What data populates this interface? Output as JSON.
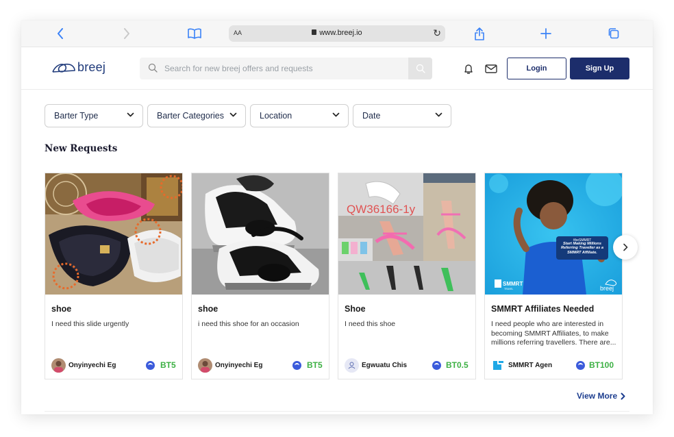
{
  "browser": {
    "aa_label": "AA",
    "url": "www.breej.io"
  },
  "header": {
    "brand": "breej",
    "search_placeholder": "Search for new breej offers and requests",
    "login_label": "Login",
    "signup_label": "Sign Up"
  },
  "filters": [
    {
      "label": "Barter Type"
    },
    {
      "label": "Barter Categories"
    },
    {
      "label": "Location"
    },
    {
      "label": "Date"
    }
  ],
  "section_title": "New Requests",
  "cards": [
    {
      "title": "shoe",
      "description": "I need this slide urgently",
      "user": "Onyinyechi Eg",
      "price": "BT5",
      "image": "pink-and-black-slides-photo"
    },
    {
      "title": "shoe",
      "description": "i need this shoe for an occasion",
      "user": "Onyinyechi Eg",
      "price": "BT5",
      "image": "black-white-sneakers-photo"
    },
    {
      "title": "Shoe",
      "description": "I need this shoe",
      "user": "Egwuatu Chis",
      "price": "BT0.5",
      "image": "pink-strappy-heels-collage",
      "image_overlay_text": "QW36166-1y"
    },
    {
      "title": "SMMRT Affiliates Needed",
      "description": "I need people who are interested in becoming SMMRT Affiliates, to make millions referring travellers. There are...",
      "user": "SMMRT Agen",
      "price": "BT100",
      "image": "smmrt-affiliate-promo-banner",
      "promo": {
        "hashtag": "#beSMMRT",
        "tagline": "Start Making Millions Referring Traveller as a SMMRT Affiliate.",
        "brand": "SMMRT",
        "brand_sub": "TRAVEL",
        "watermark": "breej"
      }
    }
  ],
  "view_more_label": "View More",
  "colors": {
    "brand_navy": "#1c2d6b",
    "price_green": "#3cb043",
    "coin_blue": "#3b5bdb",
    "safari_blue": "#3a82f7"
  }
}
